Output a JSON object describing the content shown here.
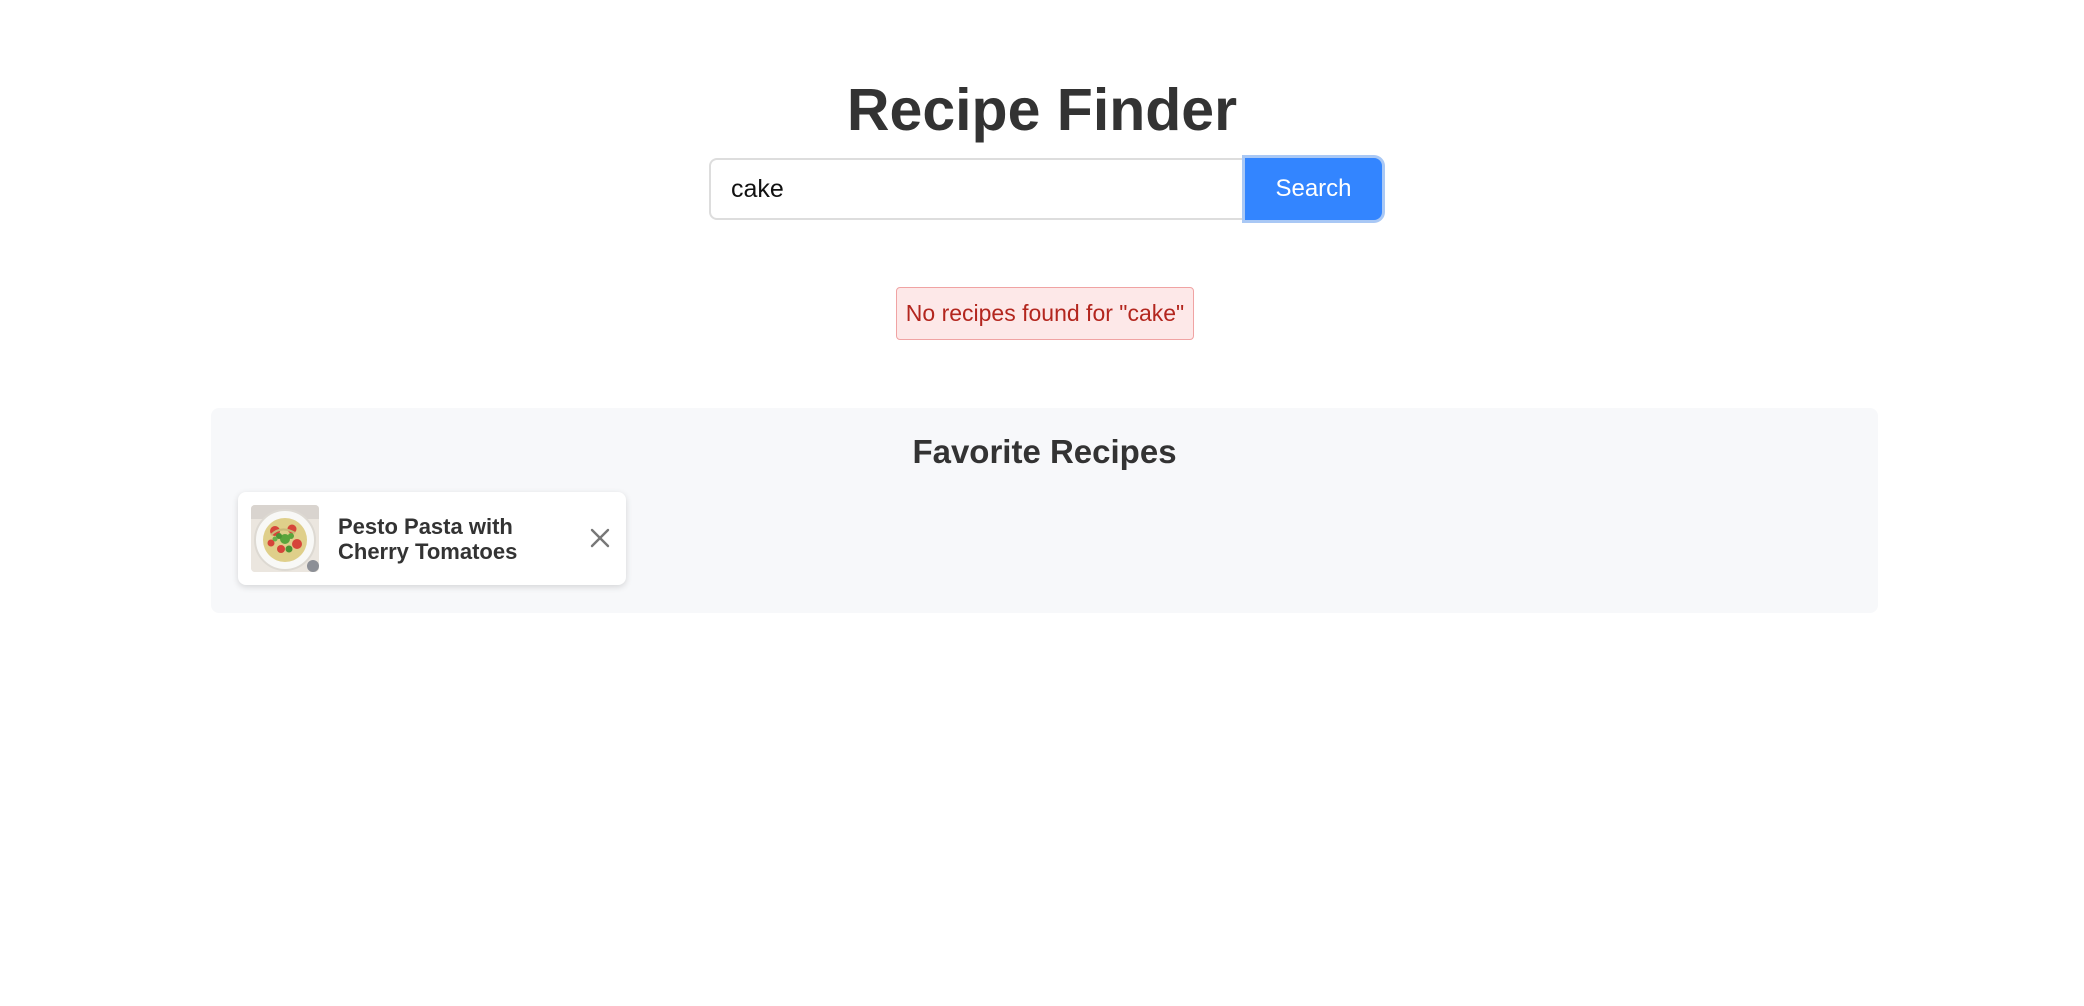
{
  "header": {
    "title": "Recipe Finder"
  },
  "search": {
    "value": "cake",
    "placeholder": "",
    "button_label": "Search"
  },
  "status": {
    "error_message": "No recipes found for \"cake\""
  },
  "favorites": {
    "title": "Favorite Recipes",
    "items": [
      {
        "name": "Pesto Pasta with Cherry Tomatoes",
        "thumbnail_icon": "pasta-dish-photo",
        "remove_icon": "close-icon"
      }
    ]
  },
  "colors": {
    "accent": "#3385ff",
    "error_text": "#b3261e",
    "error_background": "#fde8e8",
    "panel_background": "#f7f8fa"
  }
}
